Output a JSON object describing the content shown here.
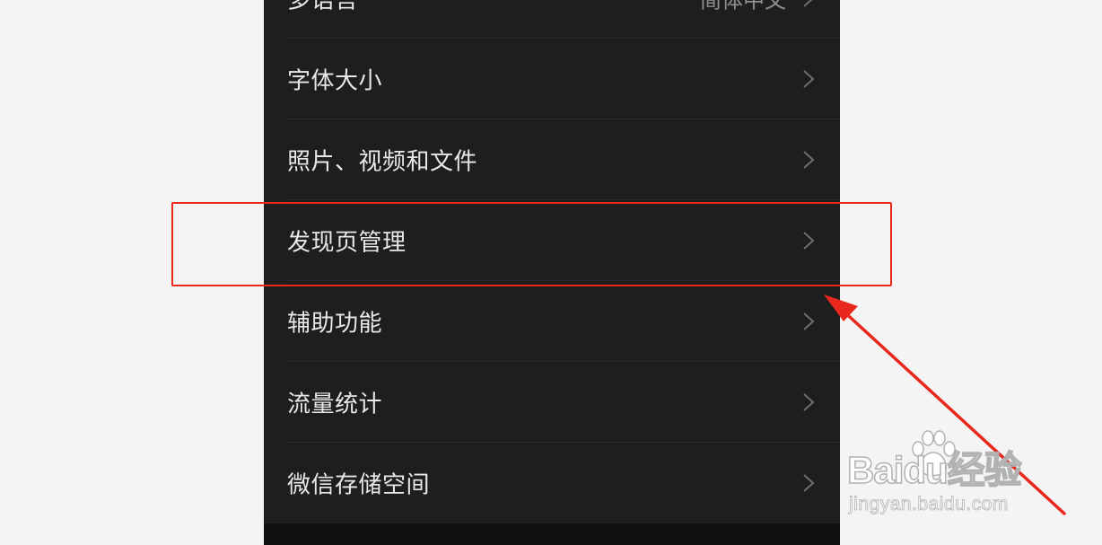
{
  "settings": {
    "items": [
      {
        "label": "多语言",
        "value": "简体中文"
      },
      {
        "label": "字体大小",
        "value": ""
      },
      {
        "label": "照片、视频和文件",
        "value": ""
      },
      {
        "label": "发现页管理",
        "value": ""
      },
      {
        "label": "辅助功能",
        "value": ""
      },
      {
        "label": "流量统计",
        "value": ""
      },
      {
        "label": "微信存储空间",
        "value": ""
      }
    ]
  },
  "annotation": {
    "highlighted_item": "发现页管理",
    "color": "#e8281d"
  },
  "watermark": {
    "brand": "Baidu经验",
    "url": "jingyan.baidu.com"
  },
  "colors": {
    "page_background": "#f4f4f4",
    "list_background": "#1e1e1e",
    "text": "#e8e8e8",
    "secondary_text": "#8f8f8f"
  }
}
